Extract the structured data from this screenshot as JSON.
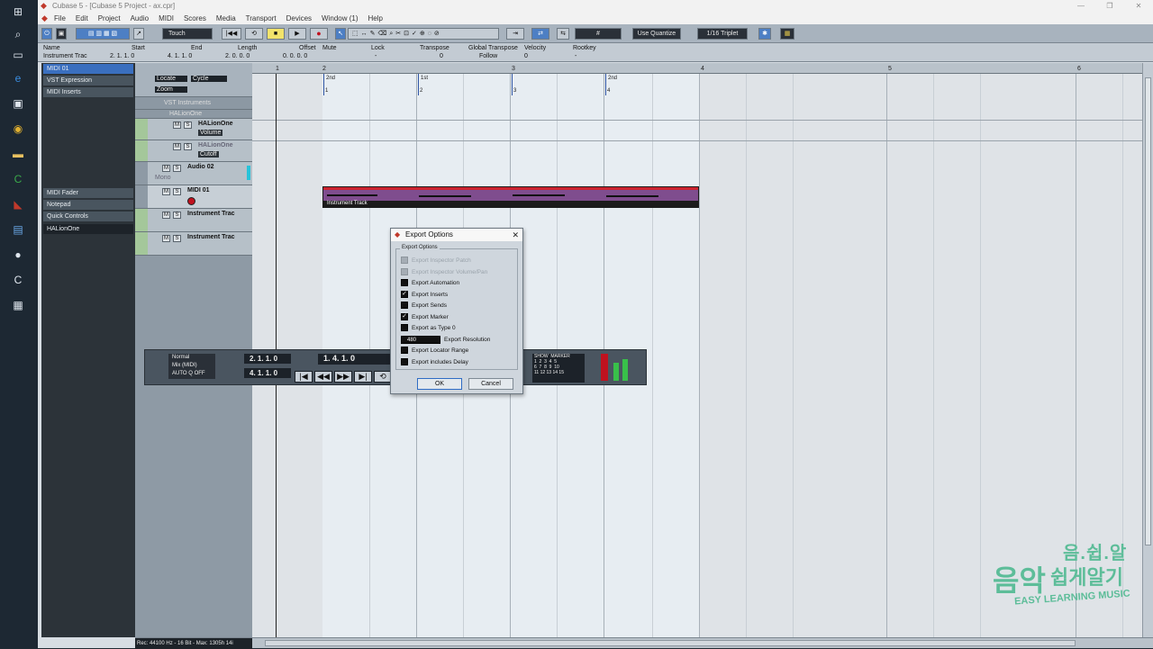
{
  "window": {
    "title": "Cubase 5 - [Cubase 5 Project - ax.cpr]",
    "minimize": "—",
    "maximize": "❐",
    "close": "✕"
  },
  "menu": [
    "File",
    "Edit",
    "Project",
    "Audio",
    "MIDI",
    "Scores",
    "Media",
    "Transport",
    "Devices",
    "Window (1)",
    "Help"
  ],
  "toolbar": {
    "automation_mode": "Touch",
    "quantize": "Use Quantize",
    "grid": "1/16 Triplet"
  },
  "infoline": {
    "labels": [
      "Name",
      "Start",
      "End",
      "Length",
      "Offset",
      "Mute",
      "Lock",
      "Transpose",
      "Global Transpose",
      "Velocity",
      "Rootkey"
    ],
    "values": [
      "Instrument Trac",
      "2. 1. 1.   0",
      "4. 1. 1.   0",
      "2. 0. 0.   0",
      "0. 0. 0.   0",
      "",
      "-",
      "0",
      "Follow",
      "0",
      "-"
    ]
  },
  "inspector": {
    "track_name": "MIDI 01",
    "sections": [
      "VST Expression",
      "MIDI Inserts",
      "MIDI Fader",
      "Notepad",
      "Quick Controls",
      "HALionOne"
    ]
  },
  "tracks": {
    "locate": "Locate",
    "cycle": "Cycle",
    "zoom": "Zoom",
    "folder_vst": "VST Instruments",
    "folder_halion": "HALionOne",
    "list": [
      {
        "name": "HALionOne",
        "sub": "Volume"
      },
      {
        "name": "HALionOne",
        "sub": "Cutoff"
      },
      {
        "name": "Audio 02",
        "sub": "Mono"
      },
      {
        "name": "MIDI 01",
        "sub": ""
      },
      {
        "name": "Instrument Trac",
        "sub": ""
      },
      {
        "name": "Instrument Trac",
        "sub": ""
      }
    ]
  },
  "ruler": {
    "bars": [
      "1",
      "2",
      "3",
      "4",
      "5",
      "6"
    ]
  },
  "markers": [
    "2nd",
    "1st",
    "",
    "2nd"
  ],
  "marker_numbers": [
    "1",
    "2",
    "3",
    "4"
  ],
  "part": {
    "label": "Instrument Track"
  },
  "transport": {
    "mode": "Normal",
    "mix": "Mix (MIDI)",
    "auto": "AUTO Q",
    "off": "OFF",
    "left_locator": "2. 1. 1.   0",
    "right_locator": "4. 1. 1.   0",
    "position": "1. 4. 1.   0",
    "show": "SHOW",
    "marker": "MARKER",
    "marker_grid": "1  2  3  4  5\n6  7  8  9  10\n11 12 13 14 15"
  },
  "dialog": {
    "title": "Export Options",
    "group_label": "Export Options",
    "options": [
      {
        "label": "Export Inspector Patch",
        "checked": false,
        "disabled": true
      },
      {
        "label": "Export Inspector Volume/Pan",
        "checked": false,
        "disabled": true
      },
      {
        "label": "Export Automation",
        "checked": false,
        "disabled": false
      },
      {
        "label": "Export Inserts",
        "checked": true,
        "disabled": false
      },
      {
        "label": "Export Sends",
        "checked": false,
        "disabled": false
      },
      {
        "label": "Export Marker",
        "checked": true,
        "disabled": false
      },
      {
        "label": "Export as Type 0",
        "checked": false,
        "disabled": false
      },
      {
        "label": "Export Locator Range",
        "checked": false,
        "disabled": false
      },
      {
        "label": "Export includes Delay",
        "checked": false,
        "disabled": false
      }
    ],
    "resolution_value": "480",
    "resolution_label": "Export Resolution",
    "ok": "OK",
    "cancel": "Cancel"
  },
  "status": "Rec: 44100 Hz - 16 Bit - Max: 1305h 14i",
  "watermark": {
    "top": "음.쉽.알",
    "big": "음악",
    "mid": "쉽게알기",
    "english": "EASY LEARNING MUSIC"
  },
  "colors": {
    "part_fill": "#7f4d8e",
    "part_top": "#cc2430",
    "cycle_zone": "#e7edf2",
    "watermark": "#5dbd99"
  }
}
